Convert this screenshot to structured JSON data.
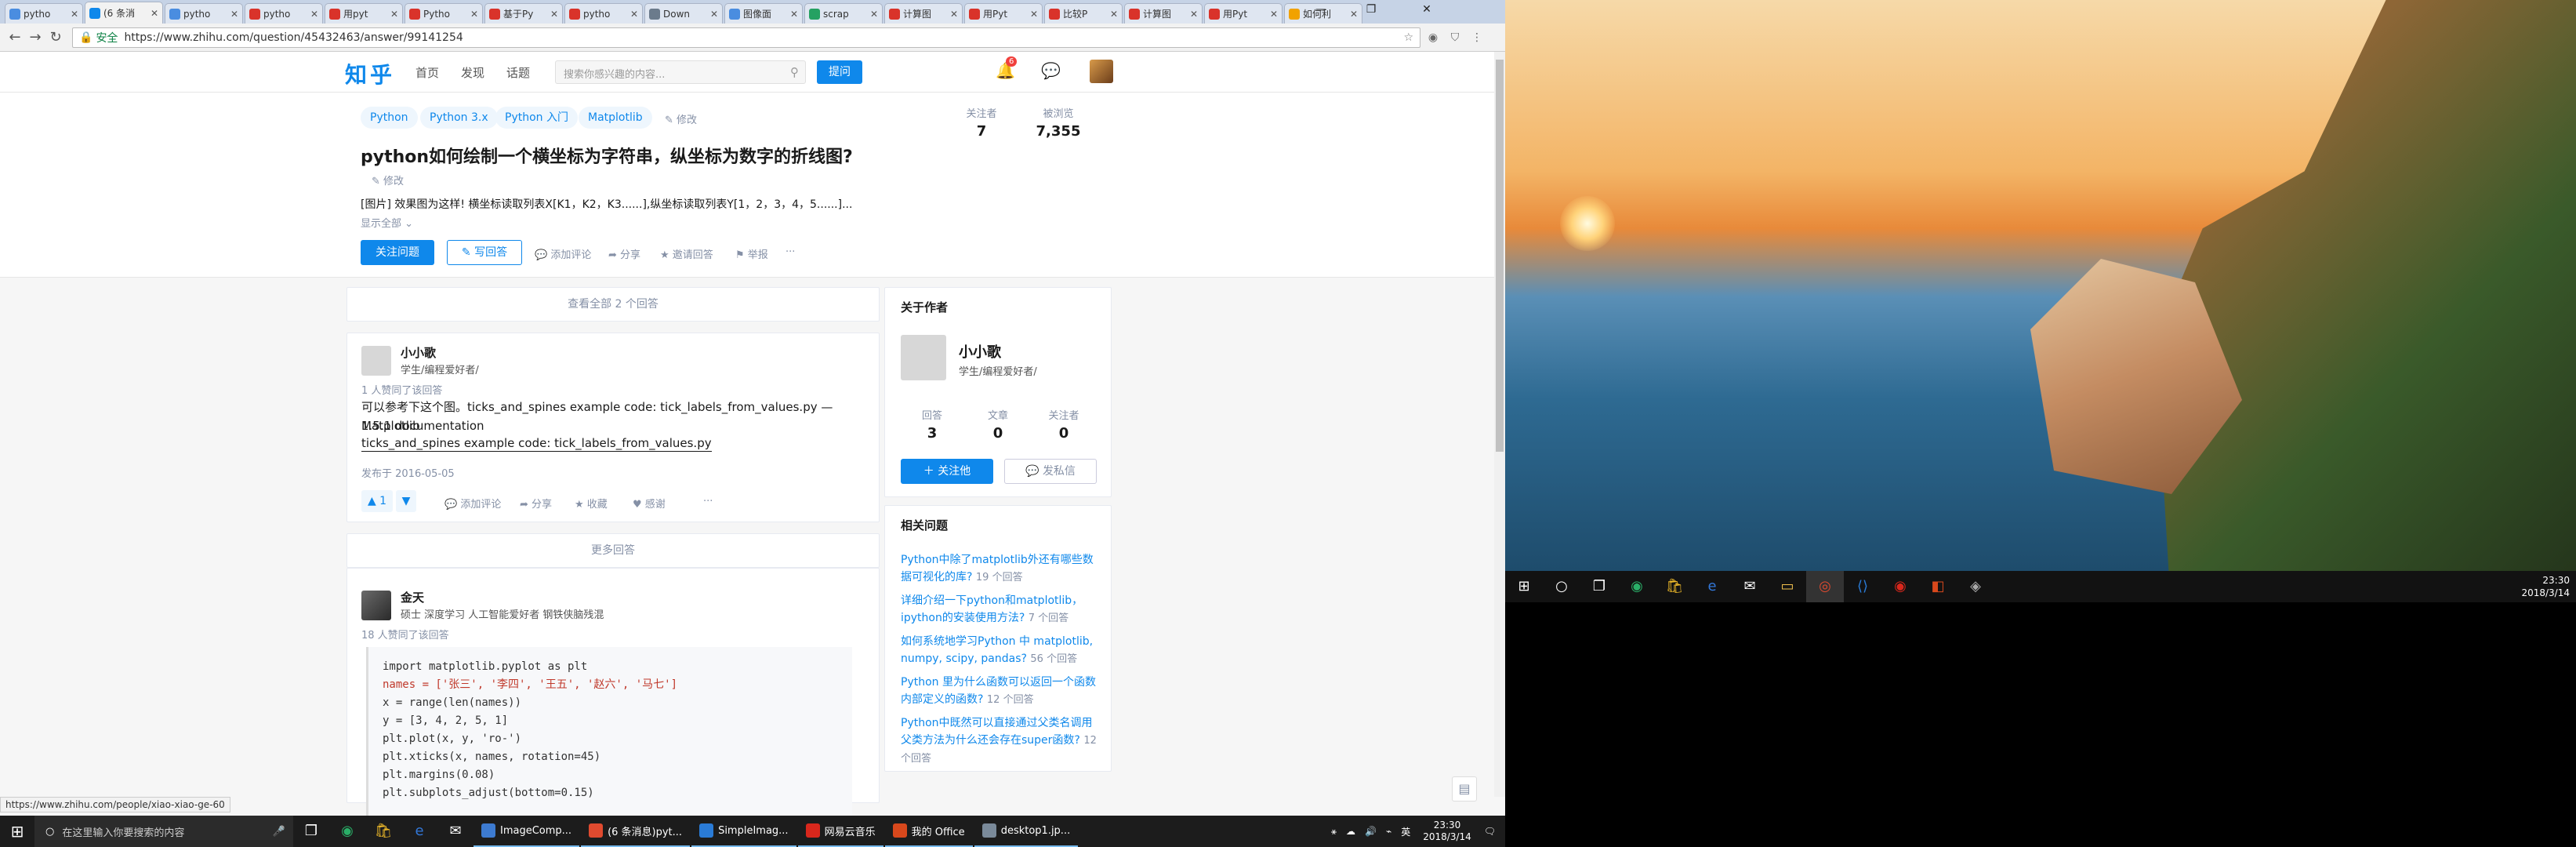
{
  "browser": {
    "tabs": [
      {
        "label": "pytho",
        "color": "#4a8de0"
      },
      {
        "label": "(6 条消",
        "color": "#0f88eb",
        "active": true
      },
      {
        "label": "pytho",
        "color": "#4a8de0"
      },
      {
        "label": "pytho",
        "color": "#d9332a"
      },
      {
        "label": "用pyt",
        "color": "#d9332a"
      },
      {
        "label": "Pytho",
        "color": "#d9332a"
      },
      {
        "label": "基于Py",
        "color": "#d9332a"
      },
      {
        "label": "pytho",
        "color": "#d9332a"
      },
      {
        "label": "Down",
        "color": "#6b7b8c"
      },
      {
        "label": "图像面",
        "color": "#4a8de0"
      },
      {
        "label": "scrap",
        "color": "#25a162"
      },
      {
        "label": "计算图",
        "color": "#d9332a"
      },
      {
        "label": "用Pyt",
        "color": "#d9332a"
      },
      {
        "label": "比较P",
        "color": "#d9332a"
      },
      {
        "label": "计算图",
        "color": "#d9332a"
      },
      {
        "label": "用Pyt",
        "color": "#d9332a"
      },
      {
        "label": "如何利",
        "color": "#f1a200"
      }
    ],
    "security_label": "安全",
    "url": "https://www.zhihu.com/question/45432463/answer/99141254",
    "status_url": "https://www.zhihu.com/people/xiao-xiao-ge-60"
  },
  "zhihu": {
    "logo": "知乎",
    "nav": [
      "首页",
      "发现",
      "话题"
    ],
    "search_placeholder": "搜索你感兴趣的内容...",
    "ask_label": "提问",
    "notif_count": "6",
    "topics": [
      "Python",
      "Python 3.x",
      "Python 入门",
      "Matplotlib"
    ],
    "modify_label": "修改",
    "question_title": "python如何绘制一个横坐标为字符串，纵坐标为数字的折线图?",
    "question_detail": "[图片] 效果图为这样! 横坐标读取列表X[K1，K2，K3......],纵坐标读取列表Y[1，2，3，4，5......]...",
    "show_all": "显示全部",
    "follow_question": "关注问题",
    "write_answer": "写回答",
    "actions": [
      "添加评论",
      "分享",
      "邀请回答",
      "举报",
      "···"
    ],
    "followers_label": "关注者",
    "followers": "7",
    "views_label": "被浏览",
    "views": "7,355",
    "view_all_answers": "查看全部 2 个回答",
    "more_answers": "更多回答"
  },
  "answer1": {
    "author": "小小歌",
    "bio": "学生/编程爱好者/",
    "agree": "1 人赞同了该回答",
    "line1": "可以参考下这个图。ticks_and_spines example code: tick_labels_from_values.py — Matplotlib",
    "line2": "1.5.1 documentation",
    "link": "ticks_and_spines example code: tick_labels_from_values.py",
    "date": "发布于 2016-05-05",
    "votes": "▲ 1",
    "actions": [
      "添加评论",
      "分享",
      "收藏",
      "感谢",
      "···"
    ]
  },
  "answer2": {
    "author": "金天",
    "bio": "硕士 深度学习 人工智能爱好者 钢铁侠脑残混",
    "agree": "18 人赞同了该回答",
    "code": [
      "import matplotlib.pyplot as plt",
      "names = ['张三', '李四', '王五', '赵六', '马七']",
      "x = range(len(names))",
      "y = [3, 4, 2, 5, 1]",
      "plt.plot(x, y, 'ro-')",
      "plt.xticks(x, names, rotation=45)",
      "plt.margins(0.08)",
      "plt.subplots_adjust(bottom=0.15)"
    ]
  },
  "about": {
    "title": "关于作者",
    "name": "小小歌",
    "bio": "学生/编程爱好者/",
    "stats": [
      {
        "label": "回答",
        "value": "3"
      },
      {
        "label": "文章",
        "value": "0"
      },
      {
        "label": "关注者",
        "value": "0"
      }
    ],
    "follow_label": "关注他",
    "message_label": "发私信"
  },
  "related": {
    "title": "相关问题",
    "items": [
      {
        "q": "Python中除了matplotlib外还有哪些数据可视化的库?",
        "c": "19 个回答"
      },
      {
        "q": "详细介绍一下python和matplotlib，ipython的安装使用方法?",
        "c": "7 个回答"
      },
      {
        "q": "如何系统地学习Python 中 matplotlib, numpy, scipy, pandas?",
        "c": "56 个回答"
      },
      {
        "q": "Python 里为什么函数可以返回一个函数内部定义的函数?",
        "c": "12 个回答"
      },
      {
        "q": "Python中既然可以直接通过父类名调用父类方法为什么还会存在super函数?",
        "c": "12 个回答"
      }
    ]
  },
  "taskbar_left": {
    "search_placeholder": "在这里输入你要搜索的内容",
    "apps": [
      {
        "label": "ImageComp...",
        "color": "#3d7bd1"
      },
      {
        "label": "(6 条消息)pyt...",
        "color": "#e04a2f"
      },
      {
        "label": "SimpleImag...",
        "color": "#2a7bd6"
      },
      {
        "label": "网易云音乐",
        "color": "#d8271c"
      },
      {
        "label": "我的 Office",
        "color": "#d8481c"
      },
      {
        "label": "desktop1.jp...",
        "color": "#7a8a9a"
      }
    ],
    "ime": "英",
    "time": "23:30",
    "date": "2018/3/14"
  },
  "taskbar_right": {
    "time": "23:30",
    "date": "2018/3/14"
  }
}
